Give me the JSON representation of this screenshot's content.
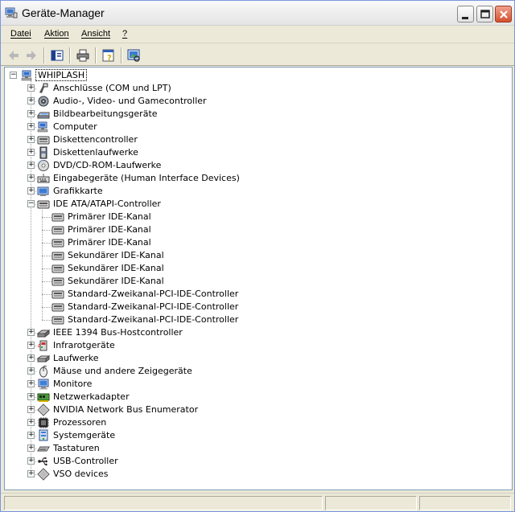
{
  "window": {
    "title": "Geräte-Manager",
    "app_icon": "device-manager-icon"
  },
  "menu": {
    "items": [
      "Datei",
      "Aktion",
      "Ansicht",
      "?"
    ]
  },
  "toolbar": {
    "buttons": [
      "back-arrow-icon",
      "forward-arrow-icon",
      "show-hide-tree-icon",
      "print-icon",
      "help-properties-icon",
      "scan-hardware-icon"
    ]
  },
  "tree": {
    "root": {
      "label": "WHIPLASH",
      "icon": "computer-icon",
      "expanded": true
    },
    "categories": [
      {
        "label": "Anschlüsse (COM und LPT)",
        "icon": "port-icon"
      },
      {
        "label": "Audio-, Video- und Gamecontroller",
        "icon": "speaker-icon"
      },
      {
        "label": "Bildbearbeitungsgeräte",
        "icon": "scanner-icon"
      },
      {
        "label": "Computer",
        "icon": "computer-icon"
      },
      {
        "label": "Diskettencontroller",
        "icon": "controller-icon"
      },
      {
        "label": "Diskettenlaufwerke",
        "icon": "floppy-icon"
      },
      {
        "label": "DVD/CD-ROM-Laufwerke",
        "icon": "cdrom-icon"
      },
      {
        "label": "Eingabegeräte (Human Interface Devices)",
        "icon": "hid-icon"
      },
      {
        "label": "Grafikkarte",
        "icon": "display-adapter-icon"
      },
      {
        "label": "IDE ATA/ATAPI-Controller",
        "icon": "ide-controller-icon",
        "expanded": true,
        "children": [
          "Primärer IDE-Kanal",
          "Primärer IDE-Kanal",
          "Primärer IDE-Kanal",
          "Sekundärer IDE-Kanal",
          "Sekundärer IDE-Kanal",
          "Sekundärer IDE-Kanal",
          "Standard-Zweikanal-PCI-IDE-Controller",
          "Standard-Zweikanal-PCI-IDE-Controller",
          "Standard-Zweikanal-PCI-IDE-Controller"
        ]
      },
      {
        "label": "IEEE 1394 Bus-Hostcontroller",
        "icon": "firewire-icon"
      },
      {
        "label": "Infrarotgeräte",
        "icon": "infrared-icon"
      },
      {
        "label": "Laufwerke",
        "icon": "drive-icon"
      },
      {
        "label": "Mäuse und andere Zeigegeräte",
        "icon": "mouse-icon"
      },
      {
        "label": "Monitore",
        "icon": "monitor-icon"
      },
      {
        "label": "Netzwerkadapter",
        "icon": "network-adapter-icon"
      },
      {
        "label": "NVIDIA Network Bus Enumerator",
        "icon": "generic-device-icon"
      },
      {
        "label": "Prozessoren",
        "icon": "processor-icon"
      },
      {
        "label": "Systemgeräte",
        "icon": "system-device-icon"
      },
      {
        "label": "Tastaturen",
        "icon": "keyboard-icon"
      },
      {
        "label": "USB-Controller",
        "icon": "usb-icon"
      },
      {
        "label": "VSO devices",
        "icon": "generic-device-icon"
      }
    ]
  },
  "status": {
    "pane1": "",
    "pane2": "",
    "pane3": ""
  }
}
